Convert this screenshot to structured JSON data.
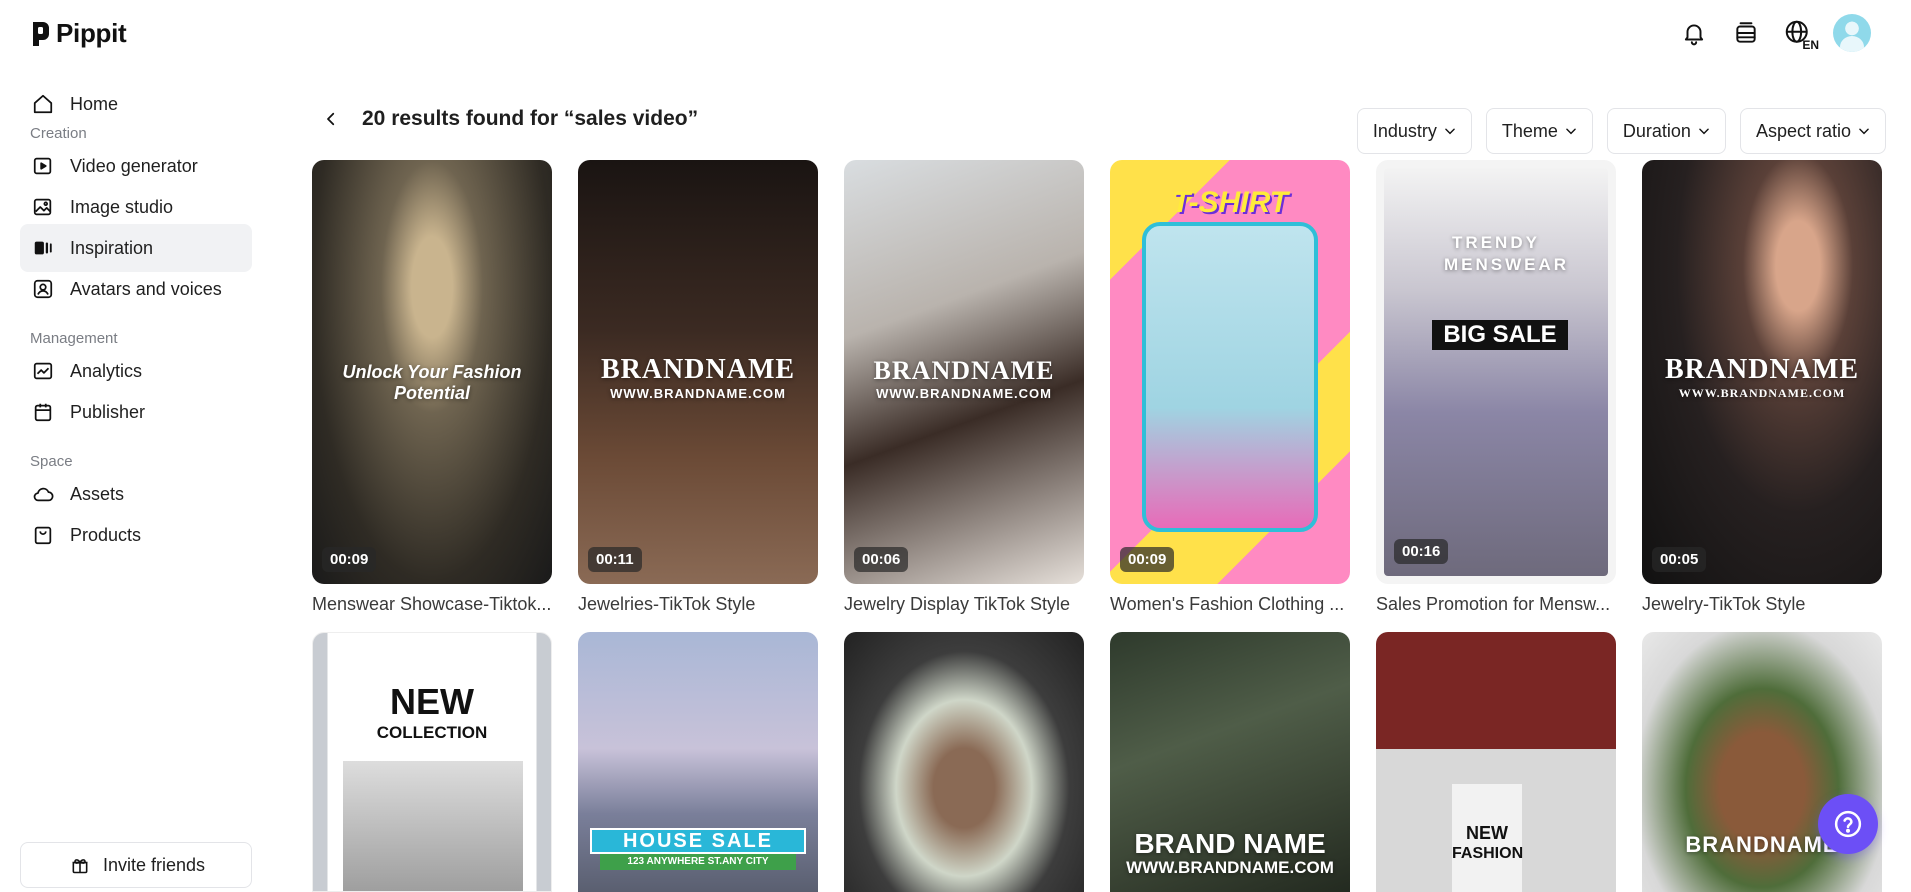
{
  "app": {
    "name": "Pippit"
  },
  "header": {
    "icons": [
      "bell-icon",
      "layers-icon",
      "globe-language-icon",
      "avatar"
    ],
    "language": "EN"
  },
  "sidebar": {
    "home": "Home",
    "sections": [
      {
        "label": "Creation",
        "items": [
          "Video generator",
          "Image studio",
          "Inspiration",
          "Avatars and voices"
        ]
      },
      {
        "label": "Management",
        "items": [
          "Analytics",
          "Publisher"
        ]
      },
      {
        "label": "Space",
        "items": [
          "Assets",
          "Products"
        ]
      }
    ],
    "active": "Inspiration",
    "invite": "Invite friends"
  },
  "search": {
    "results_title": "20 results found for “sales video”"
  },
  "filters": [
    "Industry",
    "Theme",
    "Duration",
    "Aspect ratio"
  ],
  "templates": [
    {
      "title": "Menswear Showcase-Tiktok...",
      "duration": "00:09",
      "overlay": "Unlock Your Fashion Potential"
    },
    {
      "title": "Jewelries-TikTok Style",
      "duration": "00:11",
      "overlay": "BRANDNAME",
      "overlay_sub": "WWW.BRANDNAME.COM"
    },
    {
      "title": "Jewelry Display TikTok Style",
      "duration": "00:06",
      "overlay": "BRANDNAME",
      "overlay_sub": "WWW.BRANDNAME.COM"
    },
    {
      "title": "Women's Fashion Clothing ...",
      "duration": "00:09",
      "overlay": "T-SHIRT"
    },
    {
      "title": "Sales Promotion for Mensw...",
      "duration": "00:16",
      "overlay": "TRENDY MENSWEAR",
      "overlay_sub": "BIG SALE"
    },
    {
      "title": "Jewelry-TikTok Style",
      "duration": "00:05",
      "overlay": "BRANDNAME",
      "overlay_sub": "WWW.BRANDNAME.COM"
    }
  ],
  "templates_row2": [
    {
      "overlay": "NEW",
      "overlay_sub": "COLLECTION"
    },
    {
      "overlay": "HOUSE SALE",
      "overlay_sub": "123 ANYWHERE ST.ANY CITY"
    },
    {
      "overlay": ""
    },
    {
      "overlay": "BRAND NAME",
      "overlay_sub": "WWW.BRANDNAME.COM"
    },
    {
      "overlay": "NEW",
      "overlay_sub": "FASHION"
    },
    {
      "overlay": "BRANDNAME"
    }
  ],
  "colors": {
    "accent": "#6c4ff6",
    "active_bg": "#f1f2f4",
    "text": "#1f1f1f",
    "muted": "#7a7d84"
  }
}
